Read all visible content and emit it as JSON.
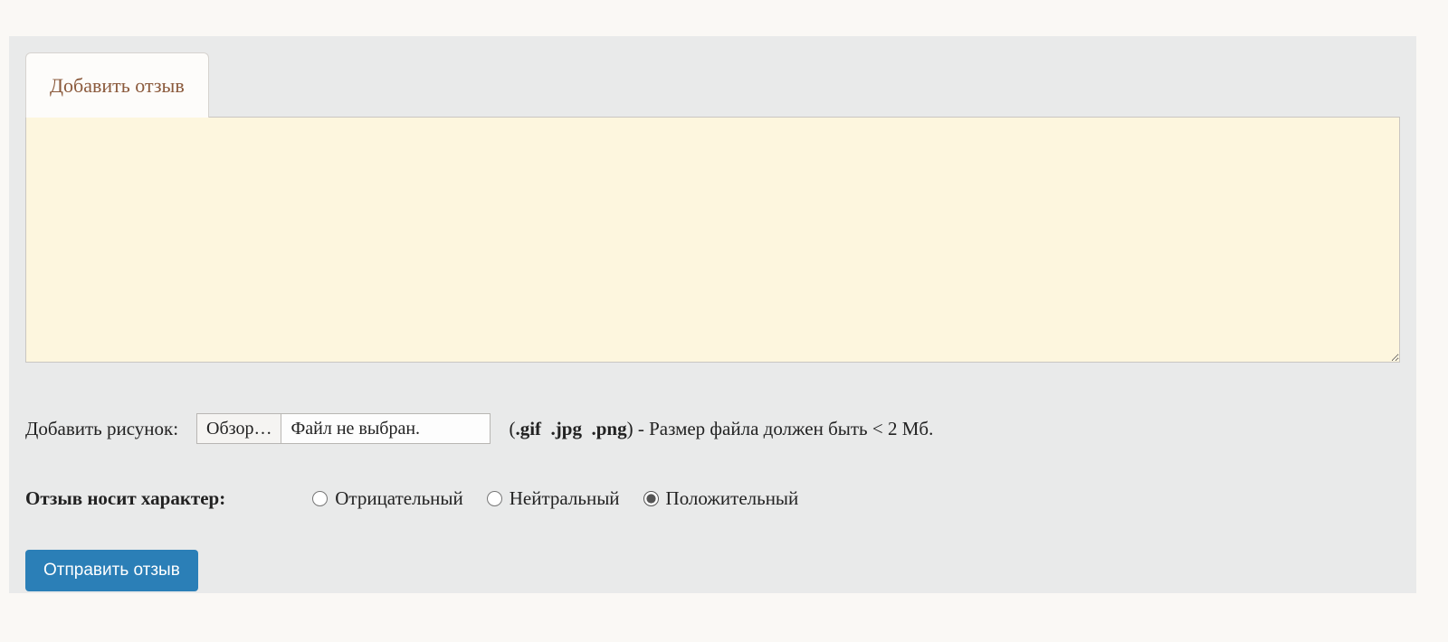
{
  "tab": {
    "label": "Добавить отзыв"
  },
  "textarea": {
    "value": ""
  },
  "file": {
    "label": "Добавить рисунок:",
    "browse": "Обзор…",
    "status": "Файл не выбран.",
    "hint_open": "(",
    "ext1": ".gif",
    "ext2": ".jpg",
    "ext3": ".png",
    "hint_rest": ") - Размер файла должен быть < 2 Мб."
  },
  "nature": {
    "label": "Отзыв носит характер:",
    "options": {
      "negative": "Отрицательный",
      "neutral": "Нейтральный",
      "positive": "Положительный"
    },
    "selected": "positive"
  },
  "submit": {
    "label": "Отправить отзыв"
  }
}
